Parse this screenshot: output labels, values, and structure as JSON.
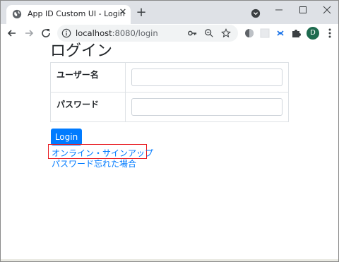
{
  "browser": {
    "tab_title": "App ID Custom UI - Login",
    "url_host": "localhost",
    "url_path": ":8080/login",
    "profile_initial": "D"
  },
  "page": {
    "heading": "ログイン",
    "username_label": "ユーザー名",
    "password_label": "パスワード",
    "username_value": "",
    "password_value": "",
    "login_button": "Login",
    "signup_link": "オンライン・サインアップ",
    "forgot_link": "パスワード忘れた場合"
  },
  "colors": {
    "primary": "#007bff",
    "highlight_border": "#e8191f",
    "tab_strip": "#dee1e6",
    "avatar": "#1e6b4f"
  },
  "icons": {
    "tab_favicon": "globe-icon",
    "tab_close": "close-icon",
    "new_tab": "plus-icon",
    "back": "arrow-left-icon",
    "forward": "arrow-right-icon",
    "reload": "reload-icon",
    "site_info": "info-icon",
    "passwords": "key-icon",
    "zoom": "zoom-icon",
    "bookmark": "star-icon",
    "extensions": "puzzle-icon",
    "menu": "kebab-menu-icon"
  }
}
